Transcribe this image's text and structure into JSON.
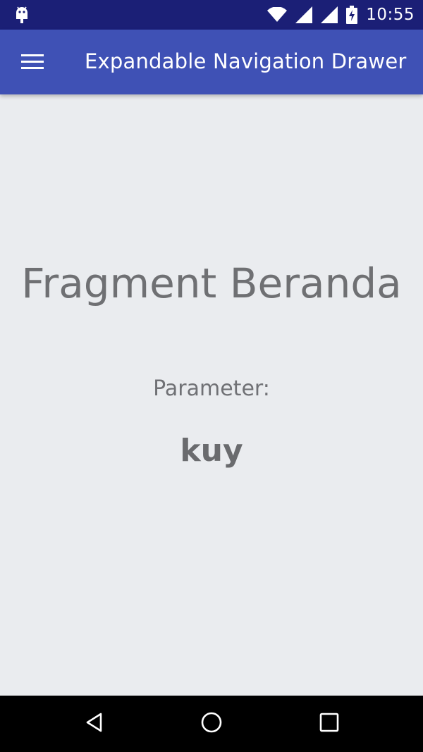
{
  "status_bar": {
    "time": "10:55",
    "icons": [
      "android-debug-icon",
      "wifi-icon",
      "signal-icon",
      "signal-icon",
      "battery-charging-icon"
    ],
    "color": "#1b1f76"
  },
  "toolbar": {
    "title": "Expandable Navigation Drawer",
    "menu_icon": "hamburger-menu-icon",
    "color": "#3f51b5"
  },
  "content": {
    "fragment_title": "Fragment Beranda",
    "parameter_label": "Parameter:",
    "parameter_value": "kuy",
    "background": "#eaecef"
  },
  "nav_bar": {
    "icons": [
      "back-icon",
      "home-icon",
      "recents-icon"
    ]
  }
}
